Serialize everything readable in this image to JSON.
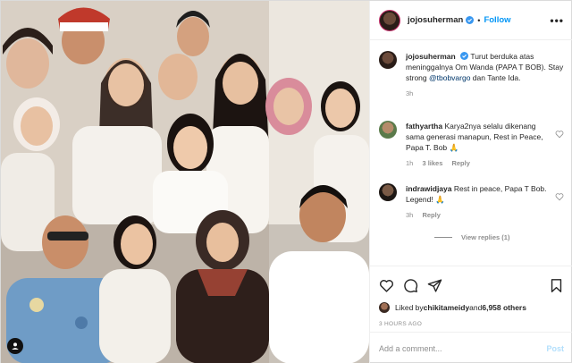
{
  "post": {
    "username": "jojosuherman",
    "follow_label": "Follow",
    "more_label": "•••",
    "separator": "•"
  },
  "caption": {
    "username": "jojosuherman",
    "text_before": "Turut berduka atas meninggalnya Om Wanda (PAPA T BOB). Stay strong ",
    "mention": "@tbobvargo",
    "text_after": " dan Tante Ida.",
    "time": "3h"
  },
  "comments": [
    {
      "username": "fathyartha",
      "text": "Karya2nya selalu dikenang sama generasi manapun, Rest in Peace, Papa T. Bob 🙏",
      "time": "1h",
      "likes": "3 likes",
      "reply_label": "Reply"
    },
    {
      "username": "indrawidjaya",
      "text": "Rest in peace, Papa T Bob. Legend! 🙏",
      "time": "3h",
      "reply_label": "Reply"
    }
  ],
  "view_replies_label": "View replies (1)",
  "actions": {
    "icons": [
      "heart-icon",
      "comment-icon",
      "share-icon",
      "save-icon"
    ]
  },
  "likes_line": {
    "prefix": "Liked by ",
    "user": "chikitameidy",
    "middle": " and ",
    "others": "6,958 others"
  },
  "post_time": "3 HOURS AGO",
  "add_comment": {
    "placeholder": "Add a comment...",
    "post_label": "Post"
  },
  "colors": {
    "link_blue": "#0095f6",
    "post_disabled": "#b2dffc",
    "meta_gray": "#8e8e8e",
    "mention": "#00376b"
  }
}
